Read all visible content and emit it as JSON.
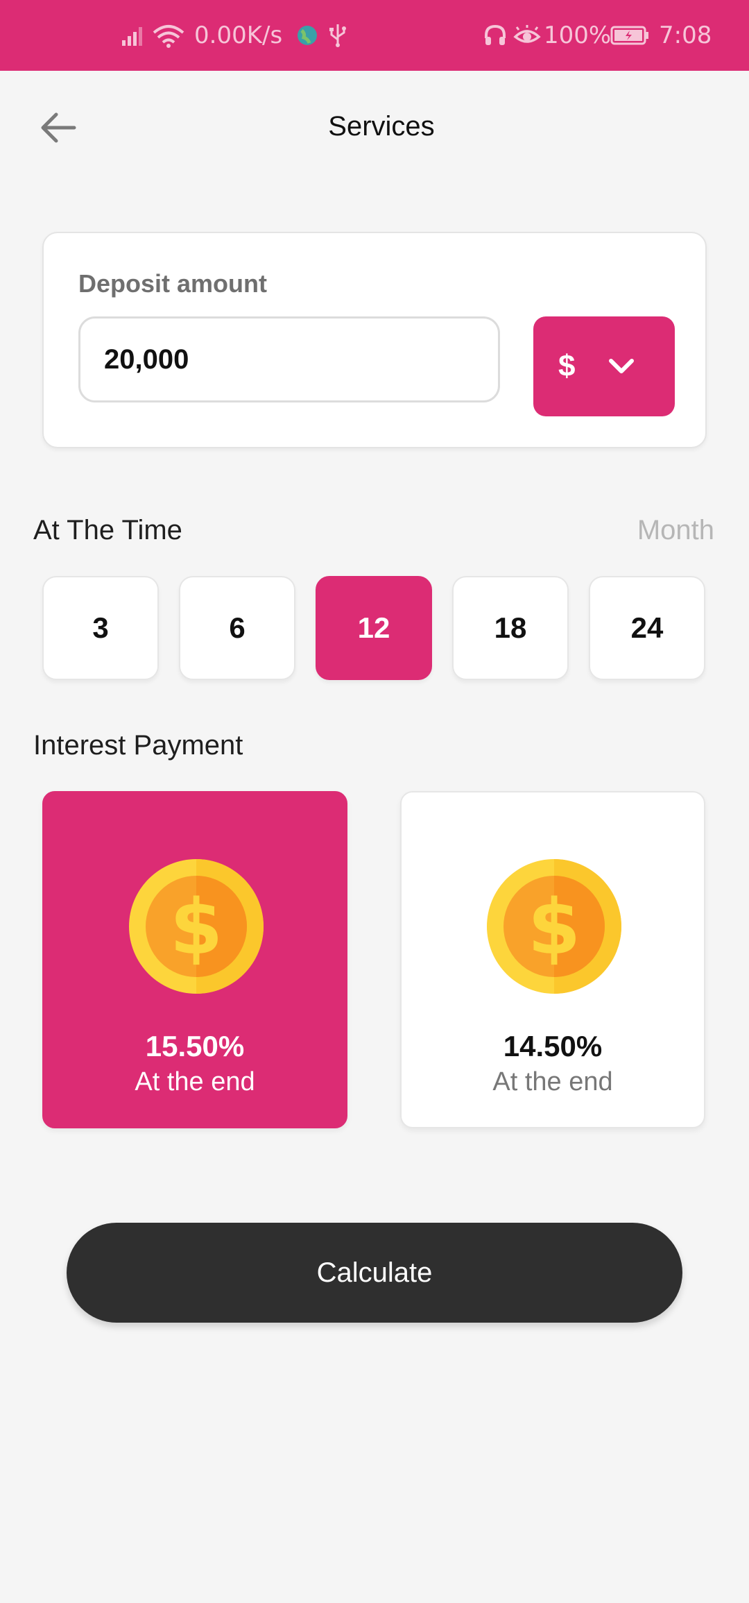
{
  "status_bar": {
    "speed": "0.00K/s",
    "battery_pct": "100%",
    "time": "7:08",
    "icons": [
      "signal-icon",
      "wifi-icon",
      "globe-icon",
      "usb-icon",
      "headset-icon",
      "eye-icon",
      "battery-icon"
    ],
    "color": "#dc2c74"
  },
  "header": {
    "title": "Services",
    "back_icon": "arrow-left-icon"
  },
  "deposit": {
    "label": "Deposit amount",
    "value": "20,000",
    "currency": "$",
    "currency_icon": "chevron-down-icon"
  },
  "time": {
    "label": "At The Time",
    "unit": "Month",
    "options": [
      "3",
      "6",
      "12",
      "18",
      "24"
    ],
    "selected": "12"
  },
  "interest": {
    "label": "Interest Payment",
    "options": [
      {
        "rate": "15.50%",
        "when": "At the end",
        "icon": "dollar-coin-icon",
        "selected": true
      },
      {
        "rate": "14.50%",
        "when": "At the end",
        "icon": "dollar-coin-icon",
        "selected": false
      }
    ]
  },
  "calculate_label": "Calculate",
  "colors": {
    "accent": "#dc2c74",
    "dark_button": "#2f2f2f",
    "background": "#f5f5f5"
  }
}
